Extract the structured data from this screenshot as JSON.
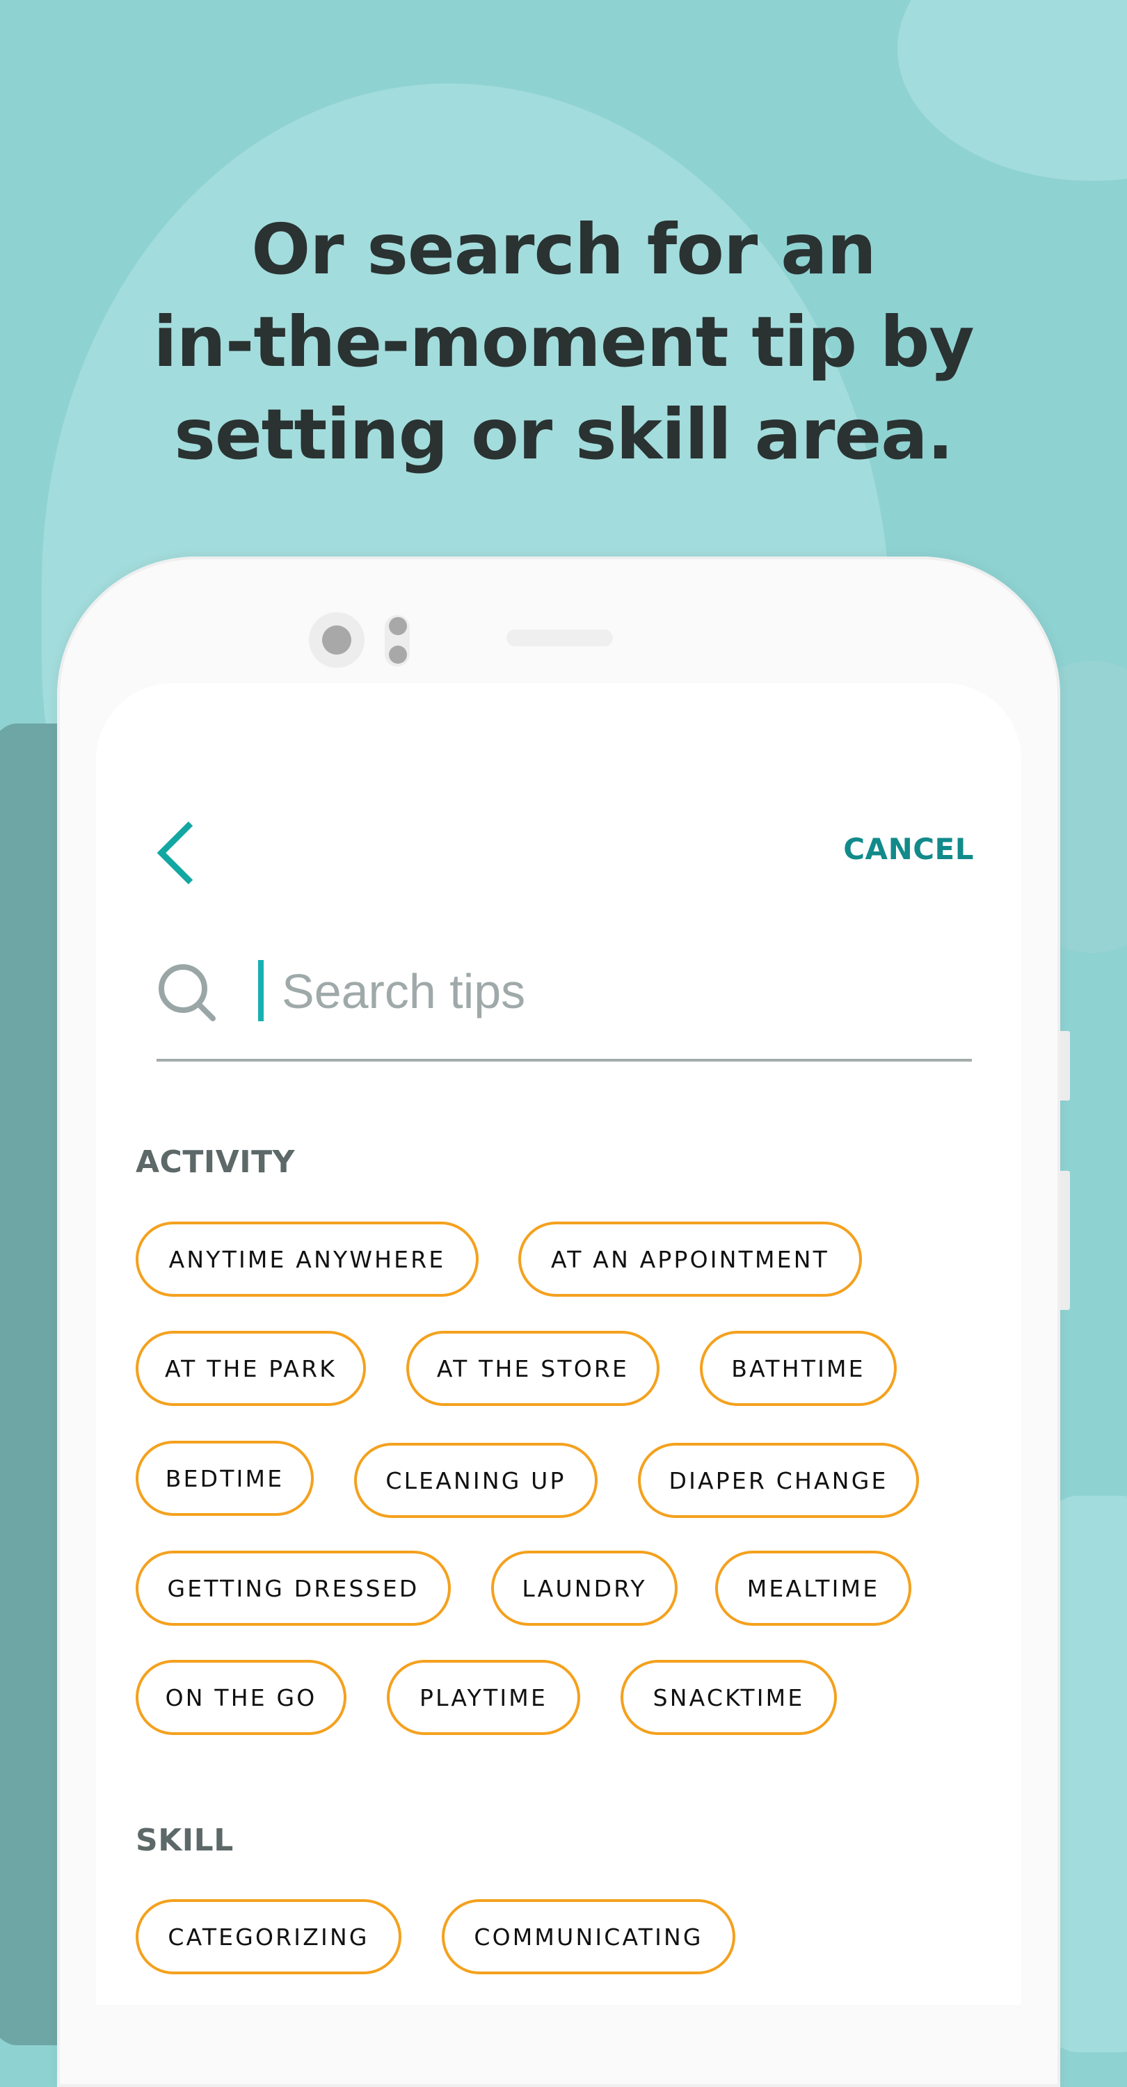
{
  "headline": {
    "lines": [
      "Or search for an",
      "in-the-moment tip by",
      "setting or skill area."
    ]
  },
  "header": {
    "back_icon": "chevron-left-icon",
    "cancel_label": "CANCEL"
  },
  "search": {
    "icon": "search-icon",
    "placeholder": "Search tips",
    "value": ""
  },
  "sections": [
    {
      "title": "ACTIVITY",
      "chips": [
        "ANYTIME ANYWHERE",
        "AT AN APPOINTMENT",
        "AT THE PARK",
        "AT THE STORE",
        "BATHTIME",
        "BEDTIME",
        "CLEANING UP",
        "DIAPER CHANGE",
        "GETTING DRESSED",
        "LAUNDRY",
        "MEALTIME",
        "ON THE GO",
        "PLAYTIME",
        "SNACKTIME"
      ]
    },
    {
      "title": "SKILL",
      "chips": [
        "CATEGORIZING",
        "COMMUNICATING"
      ]
    }
  ],
  "colors": {
    "accent": "#128a8a",
    "caret": "#16b0b0",
    "chip_border": "#f4a11e",
    "background": "#8fd2d2",
    "headline": "#2a3232",
    "section_title": "#5d6868"
  }
}
